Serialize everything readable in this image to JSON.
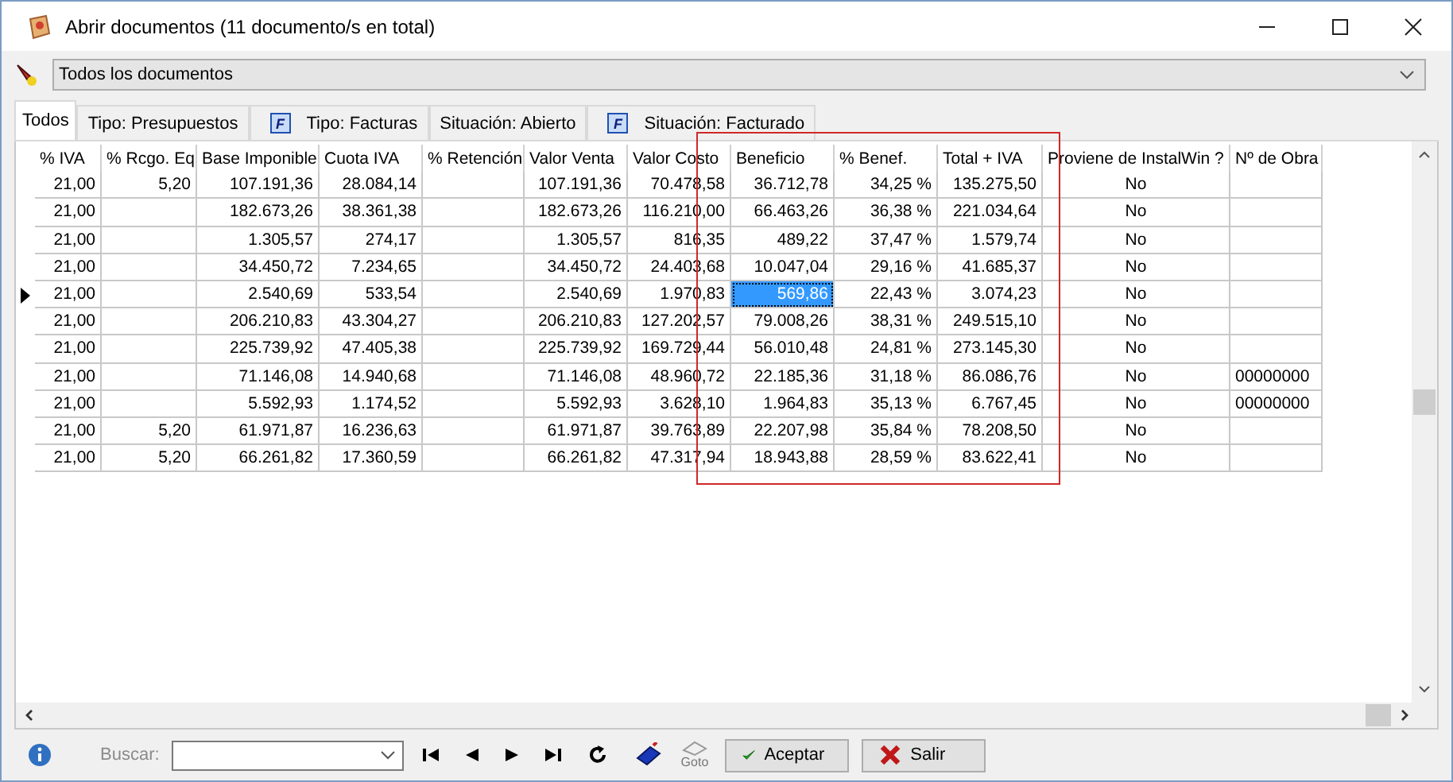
{
  "window": {
    "title": "Abrir documentos (11 documento/s en total)"
  },
  "filter": {
    "value": "Todos los documentos"
  },
  "tabs": [
    {
      "label": "Todos",
      "selected": true
    },
    {
      "label": "Tipo: Presupuestos",
      "selected": false
    },
    {
      "label": "Tipo: Facturas",
      "selected": false,
      "icon_letter": "F"
    },
    {
      "label": "Situación: Abierto",
      "selected": false
    },
    {
      "label": "Situación: Facturado",
      "selected": false,
      "icon_letter": "F"
    }
  ],
  "table": {
    "columns": [
      {
        "label": "% IVA",
        "focused": false
      },
      {
        "label": "% Rcgo. Eq",
        "focused": false
      },
      {
        "label": "Base Imponible",
        "focused": false
      },
      {
        "label": "Cuota IVA",
        "focused": false
      },
      {
        "label": "% Retención",
        "focused": false
      },
      {
        "label": "Valor Venta",
        "focused": false
      },
      {
        "label": "Valor Costo",
        "focused": false
      },
      {
        "label": "Beneficio",
        "focused": true
      },
      {
        "label": "% Benef.",
        "focused": false
      },
      {
        "label": "Total + IVA",
        "focused": false
      },
      {
        "label": "Proviene de InstalWin ?",
        "focused": false
      },
      {
        "label": "Nº de Obra",
        "focused": false
      }
    ],
    "rows": [
      {
        "current": false,
        "cells": [
          "21,00",
          "5,20",
          "107.191,36",
          "28.084,14",
          "",
          "107.191,36",
          "70.478,58",
          "36.712,78",
          "34,25 %",
          "135.275,50",
          "No",
          ""
        ]
      },
      {
        "current": false,
        "cells": [
          "21,00",
          "",
          "182.673,26",
          "38.361,38",
          "",
          "182.673,26",
          "116.210,00",
          "66.463,26",
          "36,38 %",
          "221.034,64",
          "No",
          ""
        ]
      },
      {
        "current": false,
        "cells": [
          "21,00",
          "",
          "1.305,57",
          "274,17",
          "",
          "1.305,57",
          "816,35",
          "489,22",
          "37,47 %",
          "1.579,74",
          "No",
          ""
        ]
      },
      {
        "current": false,
        "cells": [
          "21,00",
          "",
          "34.450,72",
          "7.234,65",
          "",
          "34.450,72",
          "24.403,68",
          "10.047,04",
          "29,16 %",
          "41.685,37",
          "No",
          ""
        ]
      },
      {
        "current": true,
        "cells": [
          "21,00",
          "",
          "2.540,69",
          "533,54",
          "",
          "2.540,69",
          "1.970,83",
          "569,86",
          "22,43 %",
          "3.074,23",
          "No",
          ""
        ]
      },
      {
        "current": false,
        "cells": [
          "21,00",
          "",
          "206.210,83",
          "43.304,27",
          "",
          "206.210,83",
          "127.202,57",
          "79.008,26",
          "38,31 %",
          "249.515,10",
          "No",
          ""
        ]
      },
      {
        "current": false,
        "cells": [
          "21,00",
          "",
          "225.739,92",
          "47.405,38",
          "",
          "225.739,92",
          "169.729,44",
          "56.010,48",
          "24,81 %",
          "273.145,30",
          "No",
          ""
        ]
      },
      {
        "current": false,
        "cells": [
          "21,00",
          "",
          "71.146,08",
          "14.940,68",
          "",
          "71.146,08",
          "48.960,72",
          "22.185,36",
          "31,18 %",
          "86.086,76",
          "No",
          "00000000"
        ]
      },
      {
        "current": false,
        "cells": [
          "21,00",
          "",
          "5.592,93",
          "1.174,52",
          "",
          "5.592,93",
          "3.628,10",
          "1.964,83",
          "35,13 %",
          "6.767,45",
          "No",
          "00000000"
        ]
      },
      {
        "current": false,
        "cells": [
          "21,00",
          "5,20",
          "61.971,87",
          "16.236,63",
          "",
          "61.971,87",
          "39.763,89",
          "22.207,98",
          "35,84 %",
          "78.208,50",
          "No",
          ""
        ]
      },
      {
        "current": false,
        "cells": [
          "21,00",
          "5,20",
          "66.261,82",
          "17.360,59",
          "",
          "66.261,82",
          "47.317,94",
          "18.943,88",
          "28,59 %",
          "83.622,41",
          "No",
          ""
        ]
      }
    ]
  },
  "annotation": {
    "color": "#d02828"
  },
  "toolbar": {
    "search_label": "Buscar:",
    "search_disabled": true,
    "goto_label": "Goto",
    "buttons": [
      {
        "kind": "accept",
        "label": "Aceptar"
      },
      {
        "kind": "exit",
        "label": "Salir"
      }
    ]
  }
}
